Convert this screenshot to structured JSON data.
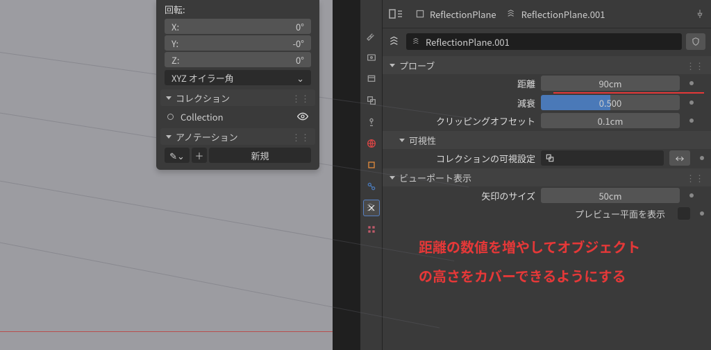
{
  "npanel": {
    "rotation_label": "回転:",
    "x": {
      "label": "X:",
      "value": "0°"
    },
    "y": {
      "label": "Y:",
      "value": "-0°"
    },
    "z": {
      "label": "Z:",
      "value": "0°"
    },
    "mode": "XYZ オイラー角",
    "section_collection": "コレクション",
    "collection_item": "Collection",
    "section_annotation": "アノテーション",
    "new_label": "新規"
  },
  "header": {
    "bc1": "ReflectionPlane",
    "bc2": "ReflectionPlane.001",
    "name": "ReflectionPlane.001"
  },
  "probe": {
    "title": "プローブ",
    "distance": {
      "label": "距離",
      "value": "90cm"
    },
    "falloff": {
      "label": "減衰",
      "value": "0.500"
    },
    "offset": {
      "label": "クリッピングオフセット",
      "value": "0.1cm"
    }
  },
  "visibility": {
    "title": "可視性",
    "coll_vis": "コレクションの可視設定"
  },
  "viewport": {
    "title": "ビューポート表示",
    "arrow": {
      "label": "矢印のサイズ",
      "value": "50cm"
    },
    "preview": "プレビュー平面を表示"
  },
  "overlay": {
    "l1": "距離の数値を増やしてオブジェクト",
    "l2": "の高さをカバーできるようにする"
  }
}
